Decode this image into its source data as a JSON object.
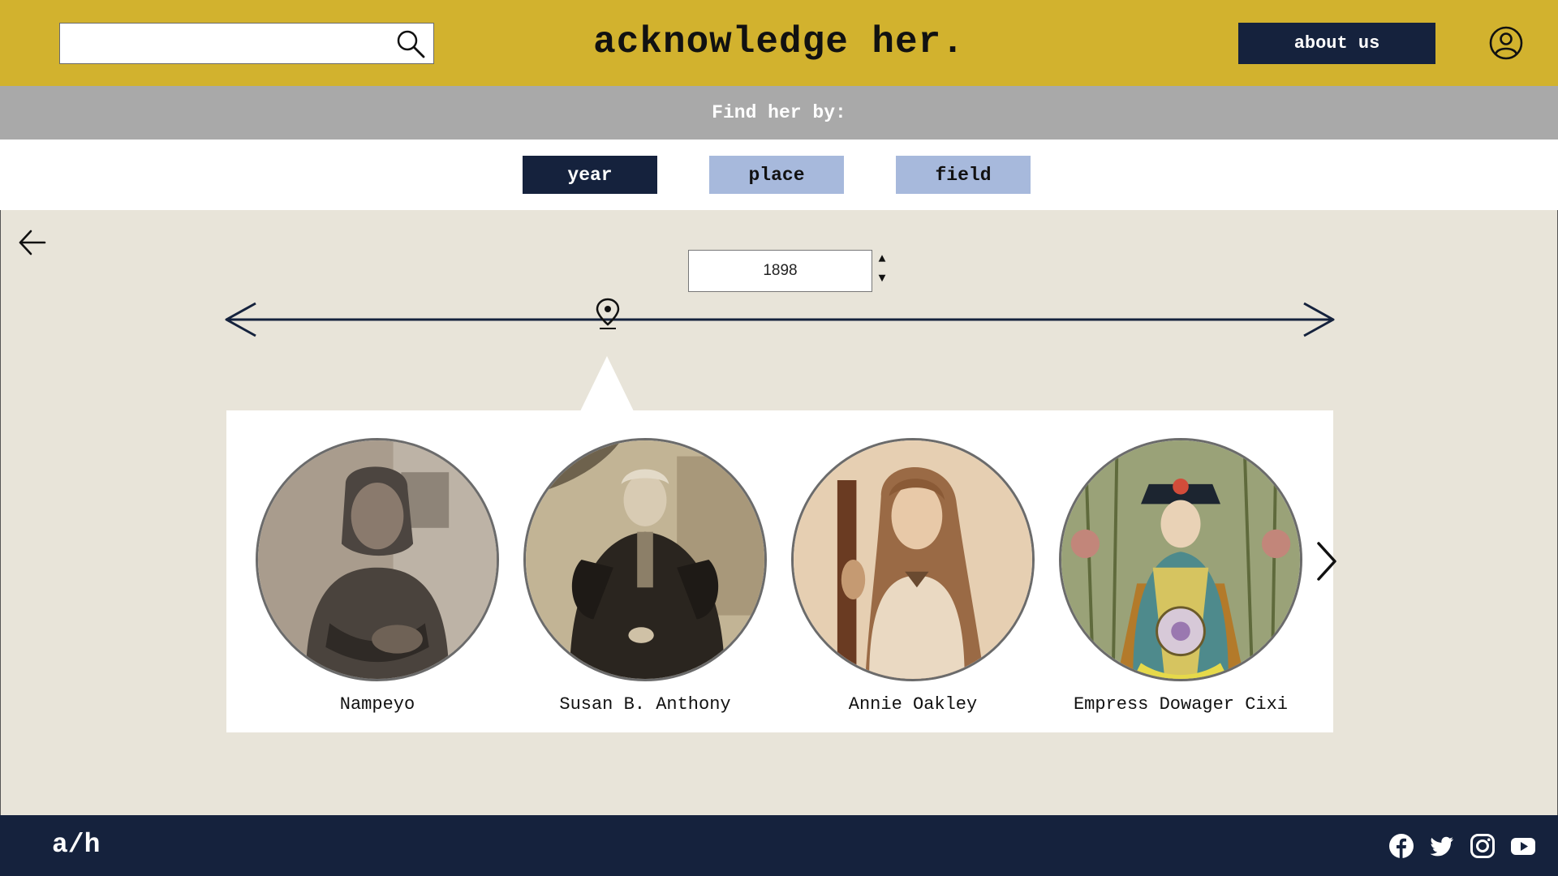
{
  "header": {
    "site_title": "acknowledge her.",
    "search_placeholder": "",
    "about_label": "about us"
  },
  "find_bar": {
    "label": "Find her by:"
  },
  "filters": [
    {
      "label": "year",
      "active": true
    },
    {
      "label": "place",
      "active": false
    },
    {
      "label": "field",
      "active": false
    }
  ],
  "main": {
    "year_value": "1898",
    "spin_up": "▲",
    "spin_down": "▼",
    "people": [
      {
        "name": "Nampeyo",
        "portrait": "sepia-photo"
      },
      {
        "name": "Susan B. Anthony",
        "portrait": "sepia-photo"
      },
      {
        "name": "Annie Oakley",
        "portrait": "sepia-photo"
      },
      {
        "name": "Empress Dowager Cixi",
        "portrait": "color-painting"
      }
    ]
  },
  "footer": {
    "logo": "a/h",
    "social_icons": [
      "facebook-icon",
      "twitter-icon",
      "instagram-icon",
      "youtube-icon"
    ]
  },
  "colors": {
    "header_bg": "#d2b22e",
    "navy": "#15223d",
    "inactive_filter": "#a7b9dc",
    "find_bar": "#a9a9a9",
    "main_bg": "#e8e4d9"
  }
}
